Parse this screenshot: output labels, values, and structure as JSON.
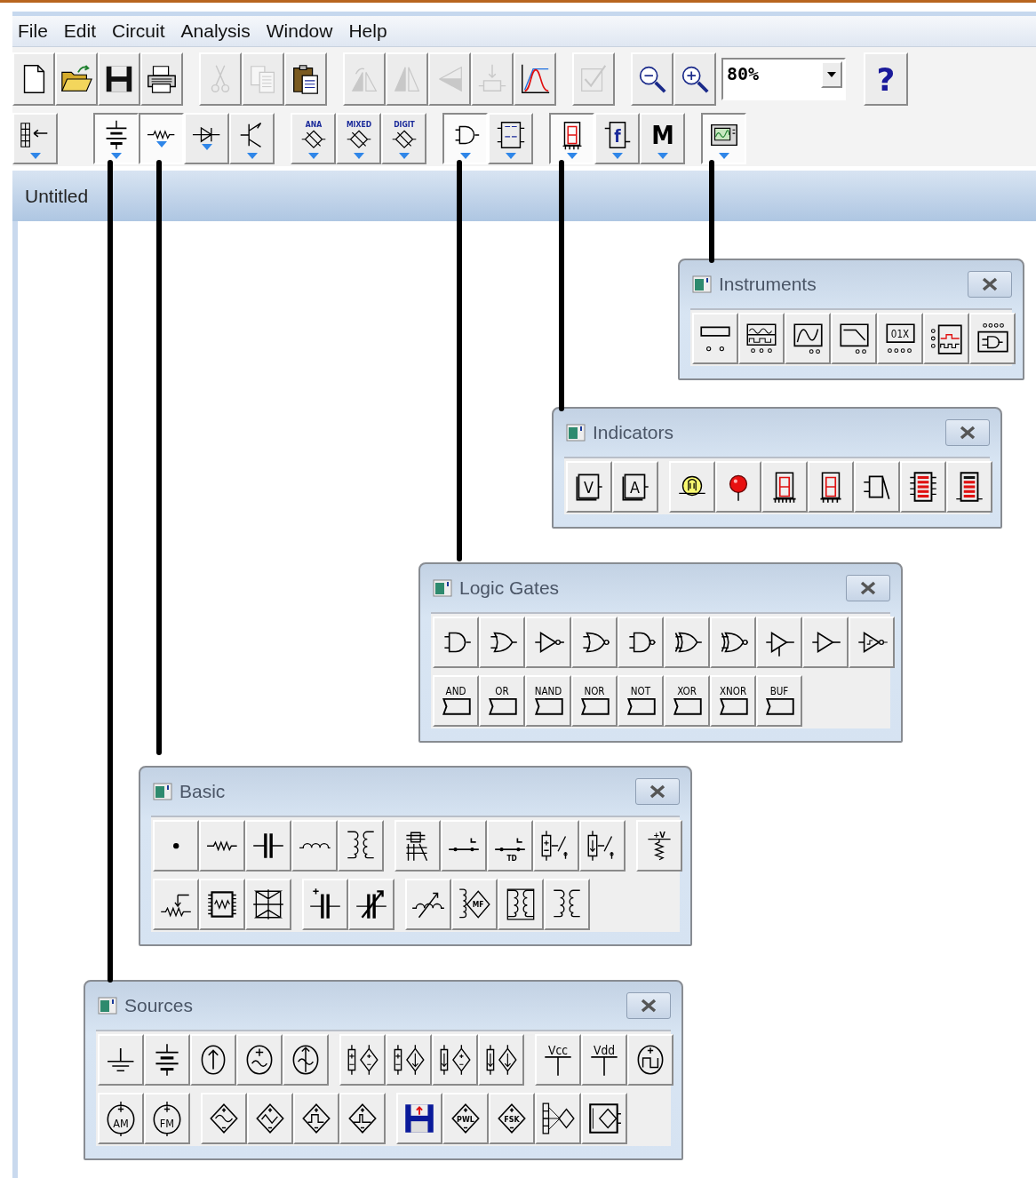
{
  "menu": [
    {
      "label": "File"
    },
    {
      "label": "Edit"
    },
    {
      "label": "Circuit"
    },
    {
      "label": "Analysis"
    },
    {
      "label": "Window"
    },
    {
      "label": "Help"
    }
  ],
  "toolbar": {
    "groups": [
      [
        {
          "kind": "document",
          "disabled": false
        },
        {
          "kind": "folder",
          "disabled": false
        },
        {
          "kind": "floppy",
          "disabled": false
        },
        {
          "kind": "printer",
          "disabled": false
        }
      ],
      [
        {
          "kind": "scissors",
          "disabled": true
        },
        {
          "kind": "copy",
          "disabled": true
        },
        {
          "kind": "clipboard",
          "disabled": false
        }
      ],
      [
        {
          "kind": "rotate",
          "disabled": true
        },
        {
          "kind": "flip-horizontal",
          "disabled": true
        },
        {
          "kind": "flip-vertical",
          "disabled": true
        },
        {
          "kind": "subcircuit",
          "disabled": true
        },
        {
          "kind": "graph",
          "disabled": false
        }
      ],
      [
        {
          "kind": "pencil-check",
          "disabled": true
        }
      ],
      [
        {
          "kind": "zoom-out",
          "disabled": false
        },
        {
          "kind": "zoom-in",
          "disabled": false
        }
      ]
    ],
    "zoom": {
      "value": "80%"
    },
    "help": {
      "label": "?"
    }
  },
  "parts_bin": {
    "groups": [
      [
        {
          "kind": "favorites",
          "selected": false
        }
      ],
      [
        {
          "kind": "battery",
          "selected": true
        },
        {
          "kind": "resistor",
          "selected": true
        },
        {
          "kind": "diode",
          "selected": false
        },
        {
          "kind": "transistor",
          "selected": false
        }
      ],
      [
        {
          "kind": "ic",
          "label": "ANA",
          "selected": false
        },
        {
          "kind": "ic",
          "label": "MIXED",
          "selected": false
        },
        {
          "kind": "ic",
          "label": "DIGIT",
          "selected": false
        }
      ],
      [
        {
          "kind": "and-gate",
          "selected": true
        },
        {
          "kind": "flip-flop",
          "selected": false
        }
      ],
      [
        {
          "kind": "seven-segment",
          "selected": true
        },
        {
          "kind": "letter-box",
          "label": "f",
          "selected": false
        },
        {
          "kind": "big-letter",
          "label": "M",
          "selected": false
        }
      ],
      [
        {
          "kind": "monitor",
          "selected": true
        }
      ]
    ]
  },
  "document": {
    "title": "Untitled"
  },
  "panels": [
    {
      "title": "Instruments",
      "rows": [
        [
          [
            {
              "kind": "multimeter"
            },
            {
              "kind": "function-generator"
            },
            {
              "kind": "oscilloscope"
            },
            {
              "kind": "bode-plotter"
            },
            {
              "kind": "word-generator",
              "label": "01X"
            },
            {
              "kind": "logic-analyzer"
            },
            {
              "kind": "logic-converter"
            }
          ]
        ]
      ]
    },
    {
      "title": "Indicators",
      "rows": [
        [
          [
            {
              "kind": "meter",
              "label": "V"
            },
            {
              "kind": "meter",
              "label": "A"
            }
          ],
          [
            {
              "kind": "bulb"
            },
            {
              "kind": "led"
            },
            {
              "kind": "seven-segment-decoded"
            },
            {
              "kind": "seven-segment"
            },
            {
              "kind": "buzzer"
            },
            {
              "kind": "bargraph-decoded"
            },
            {
              "kind": "bargraph"
            }
          ]
        ]
      ]
    },
    {
      "title": "Logic Gates",
      "rows": [
        [
          [
            {
              "kind": "and-gate"
            },
            {
              "kind": "or-gate"
            },
            {
              "kind": "not-gate"
            },
            {
              "kind": "nor-gate"
            },
            {
              "kind": "nand-gate"
            },
            {
              "kind": "xor-gate"
            },
            {
              "kind": "xnor-gate"
            },
            {
              "kind": "tristate-buffer"
            },
            {
              "kind": "buffer"
            },
            {
              "kind": "schmitt-trigger"
            }
          ]
        ],
        [
          [
            {
              "kind": "chip",
              "label": "AND"
            },
            {
              "kind": "chip",
              "label": "OR"
            },
            {
              "kind": "chip",
              "label": "NAND"
            },
            {
              "kind": "chip",
              "label": "NOR"
            },
            {
              "kind": "chip",
              "label": "NOT"
            },
            {
              "kind": "chip",
              "label": "XOR"
            },
            {
              "kind": "chip",
              "label": "XNOR"
            },
            {
              "kind": "chip",
              "label": "BUF"
            }
          ]
        ]
      ]
    },
    {
      "title": "Basic",
      "rows": [
        [
          [
            {
              "kind": "connector"
            },
            {
              "kind": "resistor"
            },
            {
              "kind": "capacitor"
            },
            {
              "kind": "inductor"
            },
            {
              "kind": "transformer"
            }
          ],
          [
            {
              "kind": "relay"
            },
            {
              "kind": "switch"
            },
            {
              "kind": "switch",
              "label": "TD"
            },
            {
              "kind": "voltage-switch"
            },
            {
              "kind": "current-switch"
            }
          ],
          [
            {
              "kind": "pull-up",
              "label": "+V"
            }
          ]
        ],
        [
          [
            {
              "kind": "potentiometer"
            },
            {
              "kind": "resistor-pack"
            },
            {
              "kind": "diode-bridge"
            }
          ],
          [
            {
              "kind": "polarized-capacitor"
            },
            {
              "kind": "variable-capacitor"
            }
          ],
          [
            {
              "kind": "variable-inductor"
            },
            {
              "kind": "core",
              "label": "MF"
            },
            {
              "kind": "coreless-coil"
            },
            {
              "kind": "transformer"
            }
          ]
        ]
      ]
    },
    {
      "title": "Sources",
      "rows": [
        [
          [
            {
              "kind": "ground"
            },
            {
              "kind": "battery"
            },
            {
              "kind": "current-source"
            },
            {
              "kind": "ac-source"
            },
            {
              "kind": "ac-current-source"
            }
          ],
          [
            {
              "kind": "dependent-source"
            },
            {
              "kind": "dependent-current"
            },
            {
              "kind": "dependent-source-b"
            },
            {
              "kind": "dependent-current-b"
            }
          ],
          [
            {
              "kind": "rail",
              "label": "Vcc"
            },
            {
              "kind": "rail",
              "label": "Vdd"
            },
            {
              "kind": "clock"
            }
          ]
        ],
        [
          [
            {
              "kind": "circle-label",
              "label": "AM"
            },
            {
              "kind": "circle-label",
              "label": "FM"
            }
          ],
          [
            {
              "kind": "diamond-sine"
            },
            {
              "kind": "diamond-triangle"
            },
            {
              "kind": "diamond-square"
            },
            {
              "kind": "diamond-pulse"
            }
          ],
          [
            {
              "kind": "disk"
            },
            {
              "kind": "diamond-label",
              "label": "PWL"
            },
            {
              "kind": "diamond-label",
              "label": "FSK"
            },
            {
              "kind": "polynomial-source"
            },
            {
              "kind": "nonlinear-source"
            }
          ]
        ]
      ]
    }
  ]
}
